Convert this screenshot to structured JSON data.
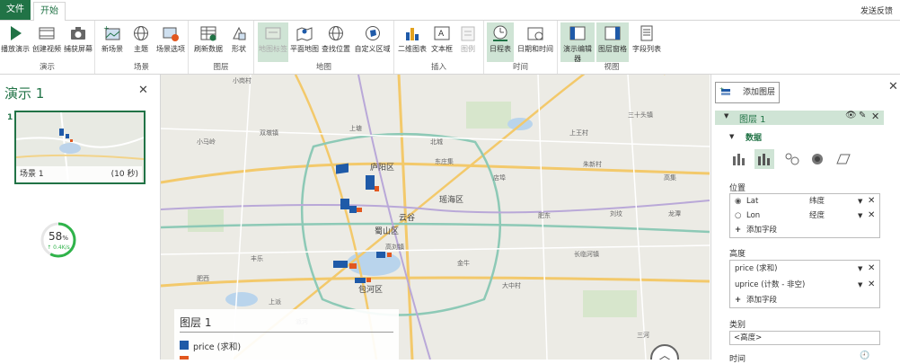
{
  "tabs": {
    "file": "文件",
    "start": "开始"
  },
  "feedback": "发送反馈",
  "ribbon": {
    "groups": [
      {
        "label": "演示"
      },
      {
        "label": "场景"
      },
      {
        "label": "图层"
      },
      {
        "label": "地图"
      },
      {
        "label": "插入"
      },
      {
        "label": "时间"
      },
      {
        "label": "视图"
      }
    ],
    "buttons": [
      {
        "label": "播放演示",
        "icon": "play-icon"
      },
      {
        "label": "创建视频",
        "icon": "video-icon"
      },
      {
        "label": "捕获屏幕",
        "icon": "camera-icon"
      },
      {
        "label": "新场景",
        "icon": "new-scene-icon"
      },
      {
        "label": "主题",
        "icon": "theme-globe-icon"
      },
      {
        "label": "场景选项",
        "icon": "scene-options-icon"
      },
      {
        "label": "刷新数据",
        "icon": "refresh-icon"
      },
      {
        "label": "形状",
        "icon": "shape-icon"
      },
      {
        "label": "地图标签",
        "icon": "map-labels-icon"
      },
      {
        "label": "平面地图",
        "icon": "flat-map-icon"
      },
      {
        "label": "查找位置",
        "icon": "find-location-icon"
      },
      {
        "label": "自定义区域",
        "icon": "custom-region-icon"
      },
      {
        "label": "二维图表",
        "icon": "chart-2d-icon"
      },
      {
        "label": "文本框",
        "icon": "textbox-icon"
      },
      {
        "label": "图例",
        "icon": "legend-icon"
      },
      {
        "label": "日程表",
        "icon": "timeline-icon"
      },
      {
        "label": "日期和时间",
        "icon": "datetime-icon"
      },
      {
        "label": "演示编辑器",
        "icon": "tour-editor-icon"
      },
      {
        "label": "图层窗格",
        "icon": "layer-pane-icon"
      },
      {
        "label": "字段列表",
        "icon": "field-list-icon"
      }
    ]
  },
  "left": {
    "title": "演示 1",
    "scene_number": "1",
    "scene_name": "场景 1",
    "scene_duration": "(10 秒)",
    "progress_percent": 58,
    "progress_text": "58",
    "progress_unit": "%",
    "progress_speed": "0.4K/s"
  },
  "map": {
    "legend_title": "图层 1",
    "legend_items": [
      "price (求和)"
    ],
    "labels": [
      "小岗村",
      "上塘",
      "双墩镇",
      "小马岭",
      "北城",
      "庐阳区",
      "瑶海区",
      "蜀山区",
      "包河区",
      "东庄集",
      "肥东",
      "刘坟",
      "高刘镇",
      "龙潭",
      "肥西",
      "三河",
      "上派",
      "上王村",
      "大中村",
      "朱新村",
      "高集",
      "派河",
      "云谷",
      "店埠",
      "长临河镇",
      "三十头镇",
      "丰乐",
      "金牛"
    ]
  },
  "right": {
    "add_layer": "添加图层",
    "layer_name": "图层 1",
    "data_label": "数据",
    "position_label": "位置",
    "position_fields": [
      {
        "name": "Lat",
        "type": "纬度"
      },
      {
        "name": "Lon",
        "type": "经度"
      }
    ],
    "add_field": "添加字段",
    "height_label": "高度",
    "height_fields": [
      "price (求和)",
      "uprice (计数 - 非空)"
    ],
    "category_label": "类别",
    "category_value": "<高度>",
    "time_label": "时间"
  },
  "colors": {
    "accent": "#217346",
    "bar_blue": "#1f5aa8",
    "bar_orange": "#e2571f"
  }
}
